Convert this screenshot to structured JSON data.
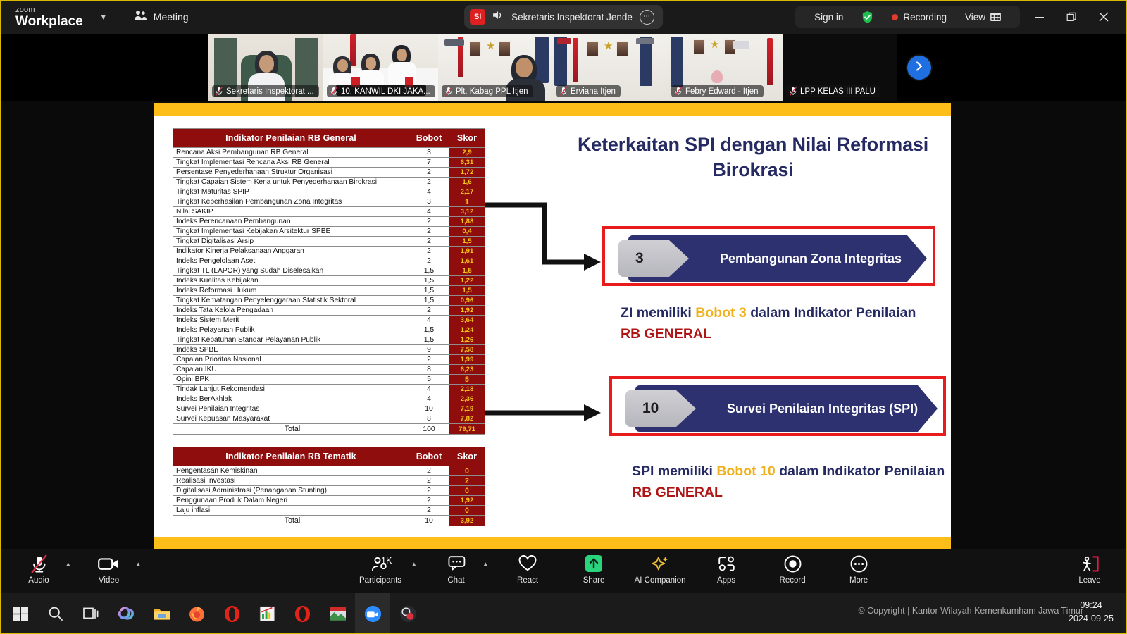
{
  "titlebar": {
    "product_line1": "zoom",
    "product_line2": "Workplace",
    "caret_icon": "chevron-down-icon",
    "meeting_label": "Meeting",
    "meeting_icon": "people-icon",
    "center": {
      "avatar_initials": "SI",
      "speaker_icon": "speaker-icon",
      "title": "Sekretaris Inspektorat Jende",
      "more_icon": "ellipsis-icon"
    },
    "right": {
      "sign_in": "Sign in",
      "shield_icon": "shield-check-icon",
      "recording": "Recording",
      "recording_icon": "record-dot-icon",
      "view": "View",
      "view_icon": "layout-grid-icon"
    },
    "window_controls": {
      "minimize": "minimize-icon",
      "restore": "restore-icon",
      "close": "close-icon"
    }
  },
  "filmstrip": {
    "next_icon": "chevron-right-icon",
    "tiles": [
      {
        "name": "Sekretaris Inspektorat ...",
        "active": true,
        "muted": true,
        "pinned": false
      },
      {
        "name": "10. KANWIL DKI JAKA...",
        "active": false,
        "muted": true,
        "pinned": false
      },
      {
        "name": "Plt. Kabag PPL Itjen",
        "active": false,
        "muted": true,
        "pinned": false
      },
      {
        "name": "Erviana Itjen",
        "active": false,
        "muted": true,
        "pinned": false
      },
      {
        "name": "Febry Edward - Itjen",
        "active": false,
        "muted": true,
        "pinned": false
      },
      {
        "name": "LPP KELAS III PALU",
        "active": false,
        "muted": true,
        "pinned": false
      }
    ]
  },
  "slide": {
    "title": "Keterkaitan SPI dengan Nilai Reformasi Birokrasi",
    "table_general": {
      "headers": [
        "Indikator Penilaian RB General",
        "Bobot",
        "Skor"
      ],
      "rows": [
        [
          "Rencana Aksi Pembangunan RB General",
          "3",
          "2,9"
        ],
        [
          "Tingkat Implementasi Rencana Aksi RB General",
          "7",
          "6,31"
        ],
        [
          "Persentase Penyederhanaan Struktur Organisasi",
          "2",
          "1,72"
        ],
        [
          "Tingkat Capaian Sistem Kerja untuk Penyederhanaan Birokrasi",
          "2",
          "1,6"
        ],
        [
          "Tingkat Maturitas SPIP",
          "4",
          "2,17"
        ],
        [
          "Tingkat Keberhasilan Pembangunan Zona Integritas",
          "3",
          "1"
        ],
        [
          "Nilai SAKIP",
          "4",
          "3,12"
        ],
        [
          "Indeks Perencanaan Pembangunan",
          "2",
          "1,88"
        ],
        [
          "Tingkat Implementasi Kebijakan Arsitektur SPBE",
          "2",
          "0,4"
        ],
        [
          "Tingkat Digitalisasi Arsip",
          "2",
          "1,5"
        ],
        [
          "Indikator Kinerja Pelaksanaan Anggaran",
          "2",
          "1,91"
        ],
        [
          "Indeks Pengelolaan Aset",
          "2",
          "1,61"
        ],
        [
          "Tingkat TL (LAPOR) yang Sudah Diselesaikan",
          "1,5",
          "1,5"
        ],
        [
          "Indeks Kualitas Kebijakan",
          "1,5",
          "1,22"
        ],
        [
          "Indeks Reformasi Hukum",
          "1,5",
          "1,5"
        ],
        [
          "Tingkat Kematangan Penyelenggaraan Statistik Sektoral",
          "1,5",
          "0,96"
        ],
        [
          "Indeks Tata Kelola Pengadaan",
          "2",
          "1,92"
        ],
        [
          "Indeks Sistem Merit",
          "4",
          "3,64"
        ],
        [
          "Indeks Pelayanan Publik",
          "1,5",
          "1,24"
        ],
        [
          "Tingkat Kepatuhan Standar Pelayanan Publik",
          "1,5",
          "1,26"
        ],
        [
          "Indeks SPBE",
          "9",
          "7,58"
        ],
        [
          "Capaian Prioritas Nasional",
          "2",
          "1,99"
        ],
        [
          "Capaian IKU",
          "8",
          "6,23"
        ],
        [
          "Opini BPK",
          "5",
          "5"
        ],
        [
          "Tindak Lanjut Rekomendasi",
          "4",
          "2,18"
        ],
        [
          "Indeks BerAkhlak",
          "4",
          "2,36"
        ],
        [
          "Survei Penilaian Integritas",
          "10",
          "7,19"
        ],
        [
          "Survei Kepuasan Masyarakat",
          "8",
          "7,82"
        ]
      ],
      "total": [
        "Total",
        "100",
        "79,71"
      ]
    },
    "table_tematik": {
      "headers": [
        "Indikator Penilaian RB Tematik",
        "Bobot",
        "Skor"
      ],
      "rows": [
        [
          "Pengentasan Kemiskinan",
          "2",
          "0"
        ],
        [
          "Realisasi Investasi",
          "2",
          "2"
        ],
        [
          "Digitalisasi Administrasi (Penanganan Stunting)",
          "2",
          "0"
        ],
        [
          "Penggunaan Produk Dalam Negeri",
          "2",
          "1,92"
        ],
        [
          "Laju inflasi",
          "2",
          "0"
        ]
      ],
      "total": [
        "Total",
        "10",
        "3,92"
      ]
    },
    "banner1": {
      "number": "3",
      "label": "Pembangunan Zona Integritas"
    },
    "caption1": {
      "p1": "ZI  memiliki ",
      "gold": "Bobot  3",
      "p2": " dalam  Indikator Penilaian ",
      "red": "RB GENERAL"
    },
    "banner2": {
      "number": "10",
      "label": "Survei Penilaian Integritas (SPI)"
    },
    "caption2": {
      "p1": "SPI  memiliki ",
      "gold": "Bobot  10",
      "p2": " dalam  Indikator Penilaian ",
      "red": "RB GENERAL"
    }
  },
  "toolbar": {
    "audio": {
      "label": "Audio",
      "icon": "microphone-muted-icon"
    },
    "video": {
      "label": "Video",
      "icon": "camera-icon"
    },
    "participants": {
      "label": "Participants",
      "icon": "people-icon",
      "count": "1K"
    },
    "chat": {
      "label": "Chat",
      "icon": "chat-bubble-icon"
    },
    "react": {
      "label": "React",
      "icon": "heart-icon"
    },
    "share": {
      "label": "Share",
      "icon": "share-arrow-up-icon"
    },
    "ai_companion": {
      "label": "AI Companion",
      "icon": "sparkle-icon"
    },
    "apps": {
      "label": "Apps",
      "icon": "apps-icon"
    },
    "record": {
      "label": "Record",
      "icon": "record-circle-icon"
    },
    "more": {
      "label": "More",
      "icon": "ellipsis-icon"
    },
    "leave": {
      "label": "Leave",
      "icon": "leave-door-icon"
    }
  },
  "taskbar": {
    "items": [
      {
        "name": "start-button",
        "icon": "windows-logo-icon"
      },
      {
        "name": "search-button",
        "icon": "magnifier-icon"
      },
      {
        "name": "task-view-button",
        "icon": "task-view-icon"
      },
      {
        "name": "copilot-button",
        "icon": "copilot-icon"
      },
      {
        "name": "file-explorer-button",
        "icon": "folder-icon"
      },
      {
        "name": "firefox-button",
        "icon": "firefox-icon"
      },
      {
        "name": "opera-button",
        "icon": "opera-icon"
      },
      {
        "name": "spreadsheet-button",
        "icon": "spreadsheet-icon"
      },
      {
        "name": "opera-gx-button",
        "icon": "opera-icon"
      },
      {
        "name": "photos-button",
        "icon": "photo-icon"
      },
      {
        "name": "zoom-button",
        "icon": "zoom-app-icon"
      },
      {
        "name": "obs-button",
        "icon": "obs-icon"
      }
    ],
    "clock_time": "09:24",
    "clock_date": "2024-09-25"
  },
  "overlay": {
    "copyright": "© Copyright | Kantor Wilayah Kemenkumham Jawa Timur"
  },
  "colors": {
    "accent_yellow": "#fdbe1a",
    "table_red": "#8f0d0d",
    "banner_navy": "#2e3170",
    "banner_border_red": "#e81c1c",
    "gold_text": "#f0b21c",
    "active_green": "#3ee07f"
  }
}
